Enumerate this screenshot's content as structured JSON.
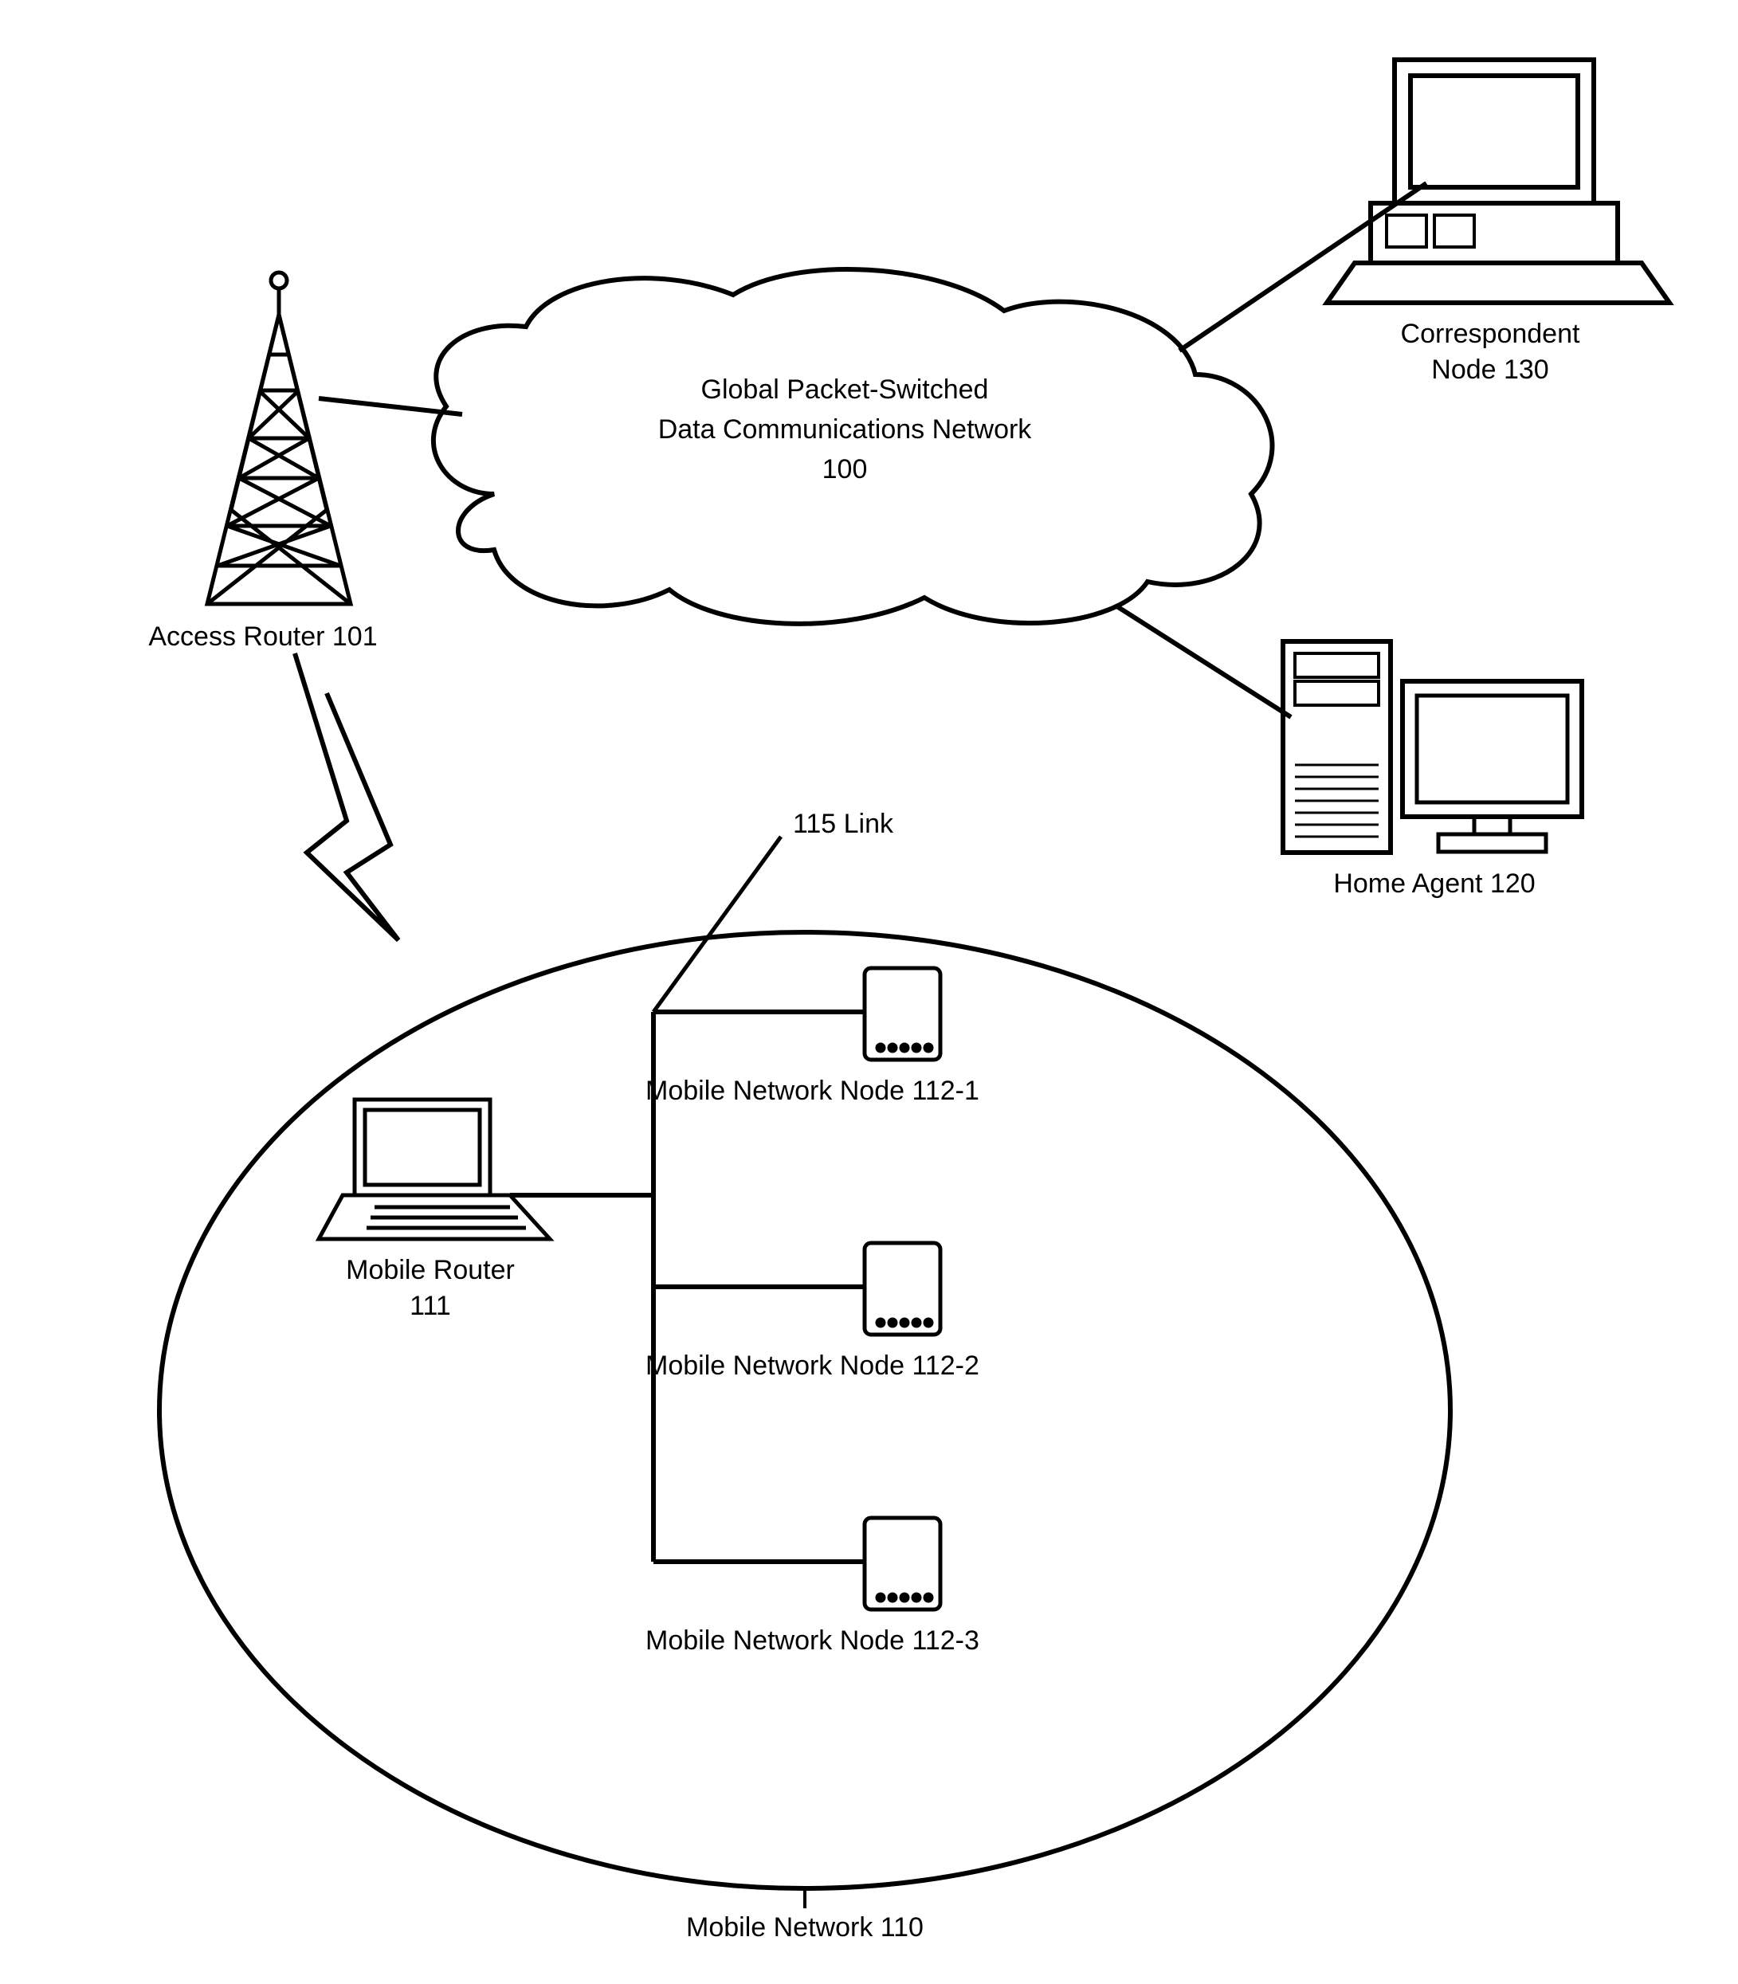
{
  "cloud": {
    "line1": "Global Packet-Switched",
    "line2": "Data Communications Network",
    "line3": "100"
  },
  "access_router": "Access Router 101",
  "correspondent_node": {
    "line1": "Correspondent",
    "line2": "Node 130"
  },
  "home_agent": "Home Agent 120",
  "link_label": "115 Link",
  "mobile_router": {
    "line1": "Mobile Router",
    "line2": "111"
  },
  "mnn1": "Mobile Network Node 112-1",
  "mnn2": "Mobile Network Node 112-2",
  "mnn3": "Mobile Network Node 112-3",
  "mobile_network": "Mobile Network 110"
}
